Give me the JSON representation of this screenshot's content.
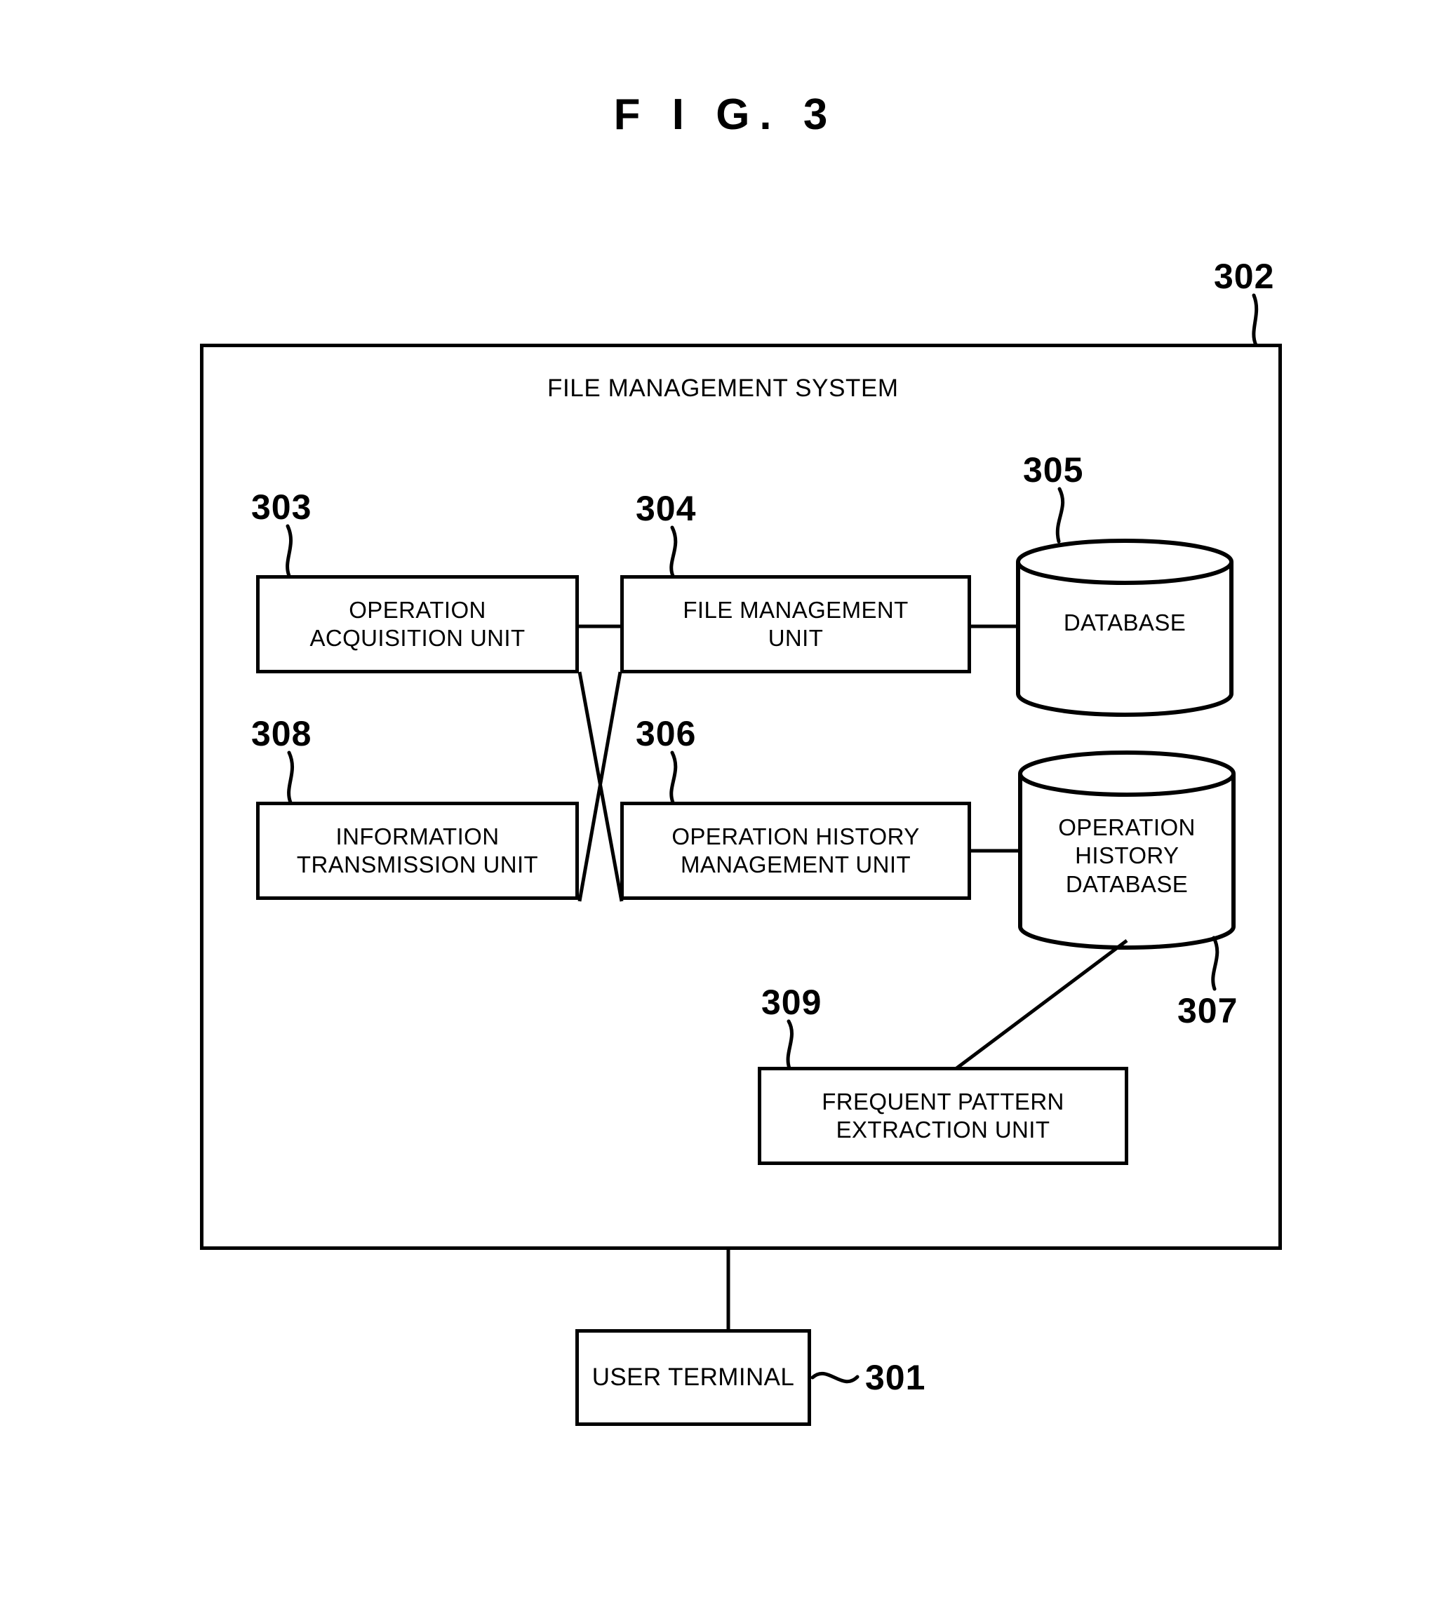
{
  "figure": {
    "title": "F I G.  3"
  },
  "system": {
    "title": "FILE MANAGEMENT SYSTEM",
    "ref": "302"
  },
  "blocks": {
    "operation_acquisition_unit": {
      "ref": "303",
      "line1": "OPERATION",
      "line2": "ACQUISITION UNIT"
    },
    "file_management_unit": {
      "ref": "304",
      "line1": "FILE MANAGEMENT",
      "line2": "UNIT"
    },
    "information_transmission_unit": {
      "ref": "308",
      "line1": "INFORMATION",
      "line2": "TRANSMISSION UNIT"
    },
    "operation_history_management_unit": {
      "ref": "306",
      "line1": "OPERATION HISTORY",
      "line2": "MANAGEMENT UNIT"
    },
    "frequent_pattern_extraction_unit": {
      "ref": "309",
      "line1": "FREQUENT PATTERN",
      "line2": "EXTRACTION UNIT"
    },
    "user_terminal": {
      "ref": "301",
      "line1": "USER TERMINAL"
    }
  },
  "databases": {
    "database": {
      "ref": "305",
      "line1": "DATABASE"
    },
    "operation_history_database": {
      "ref": "307",
      "line1": "OPERATION",
      "line2": "HISTORY",
      "line3": "DATABASE"
    }
  },
  "colors": {
    "stroke": "#000000",
    "fill": "#ffffff"
  }
}
